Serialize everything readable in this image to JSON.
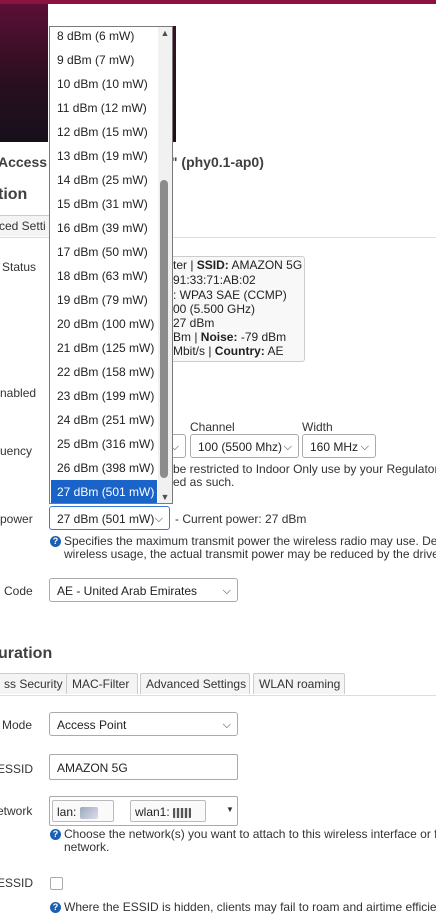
{
  "header": {
    "title_left": "Access",
    "title_right": "G\" (phy0.1-ap0)"
  },
  "device_config": {
    "section_title": "tion",
    "tab_partial": "ced Setti",
    "status_label": "Status",
    "status": {
      "line1_pre": "ter | ",
      "line1_ssid_label": "SSID:",
      "line1_ssid_value": " AMAZON 5G",
      "line2": "91:33:71:AB:02",
      "line3": ": WPA3 SAE (CCMP)",
      "line4": "00 (5.500 GHz)",
      "line5": "27 dBm",
      "line6_pre": "Bm | ",
      "line6_noise_label": "Noise:",
      "line6_noise_value": " -79 dBm",
      "line7_pre": "Mbit/s | ",
      "line7_country_label": "Country:",
      "line7_country_value": " AE"
    },
    "enabled_label": "nabled",
    "frequency_label": "uency",
    "channel_label": "Channel",
    "width_label": "Width",
    "channel_value": "100 (5500 Mhz)",
    "width_value": "160 MHz",
    "freq_note_line1": "be restricted to Indoor Only use by your Regulatory",
    "freq_note_line2": "ed as such.",
    "power_label": "power",
    "power_value": "27 dBm (501 mW)",
    "current_power": "- Current power: 27 dBm",
    "power_help_line1": "Specifies the maximum transmit power the wireless radio may use. Depe",
    "power_help_line2": "wireless usage, the actual transmit power may be reduced by the driver.",
    "country_label": "Code",
    "country_value": "AE - United Arab Emirates"
  },
  "dropdown": {
    "options": [
      "8 dBm (6 mW)",
      "9 dBm (7 mW)",
      "10 dBm (10 mW)",
      "11 dBm (12 mW)",
      "12 dBm (15 mW)",
      "13 dBm (19 mW)",
      "14 dBm (25 mW)",
      "15 dBm (31 mW)",
      "16 dBm (39 mW)",
      "17 dBm (50 mW)",
      "18 dBm (63 mW)",
      "19 dBm (79 mW)",
      "20 dBm (100 mW)",
      "21 dBm (125 mW)",
      "22 dBm (158 mW)",
      "23 dBm (199 mW)",
      "24 dBm (251 mW)",
      "25 dBm (316 mW)",
      "26 dBm (398 mW)",
      "27 dBm (501 mW)"
    ],
    "selected_index": 19
  },
  "interface_config": {
    "section_title": "uration",
    "tabs": [
      "ss Security",
      "MAC-Filter",
      "Advanced Settings",
      "WLAN roaming"
    ],
    "mode_label": "Mode",
    "mode_value": "Access Point",
    "essid_label": "ESSID",
    "essid_value": "AMAZON 5G",
    "network_label": "etwork",
    "network_chips": [
      "lan:",
      "wlan1:"
    ],
    "network_help_line1": "Choose the network(s) you want to attach to this wireless interface or fill",
    "network_help_line2": "network.",
    "hide_essid_label": "ESSID",
    "hide_help": "Where the ESSID is hidden, clients may fail to roam and airtime efficienc"
  },
  "colors": {
    "selected_option": "#1a63c8",
    "info_icon": "#1a5fb4",
    "brand_bar": "#8a1340"
  }
}
